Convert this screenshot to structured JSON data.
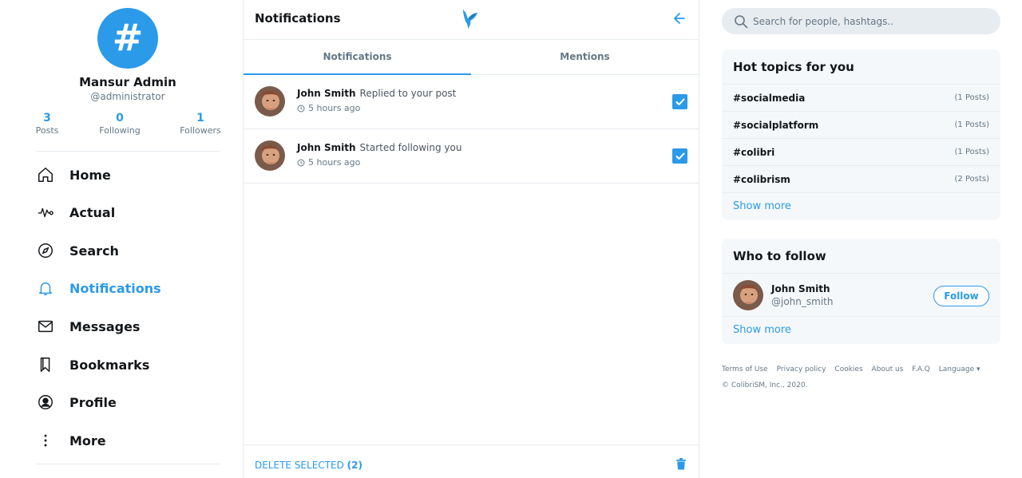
{
  "profile": {
    "avatar_symbol": "#",
    "name": "Mansur Admin",
    "handle": "@administrator",
    "stats": [
      {
        "value": "3",
        "label": "Posts"
      },
      {
        "value": "0",
        "label": "Following"
      },
      {
        "value": "1",
        "label": "Followers"
      }
    ]
  },
  "nav": {
    "items": [
      {
        "label": "Home",
        "icon": "home-icon"
      },
      {
        "label": "Actual",
        "icon": "activity-icon"
      },
      {
        "label": "Search",
        "icon": "compass-icon"
      },
      {
        "label": "Notifications",
        "icon": "bell-icon",
        "active": true
      },
      {
        "label": "Messages",
        "icon": "envelope-icon"
      },
      {
        "label": "Bookmarks",
        "icon": "bookmark-icon"
      },
      {
        "label": "Profile",
        "icon": "user-circle-icon"
      },
      {
        "label": "More",
        "icon": "more-vertical-icon"
      }
    ]
  },
  "main": {
    "title": "Notifications",
    "tabs": [
      {
        "label": "Notifications",
        "active": true
      },
      {
        "label": "Mentions",
        "active": false
      }
    ],
    "notifications": [
      {
        "name": "John Smith",
        "action": "Replied to your post",
        "time": "5 hours ago",
        "checked": true
      },
      {
        "name": "John Smith",
        "action": "Started following you",
        "time": "5 hours ago",
        "checked": true
      }
    ],
    "footer": {
      "delete_label": "DELETE SELECTED",
      "count": "(2)"
    }
  },
  "search": {
    "placeholder": "Search for people, hashtags.."
  },
  "hot_topics": {
    "title": "Hot topics for you",
    "items": [
      {
        "tag": "#socialmedia",
        "count": "(1 Posts)"
      },
      {
        "tag": "#socialplatform",
        "count": "(1 Posts)"
      },
      {
        "tag": "#colibri",
        "count": "(1 Posts)"
      },
      {
        "tag": "#colibrism",
        "count": "(2 Posts)"
      }
    ],
    "show_more": "Show more"
  },
  "who_to_follow": {
    "title": "Who to follow",
    "user": {
      "name": "John Smith",
      "handle": "@john_smith"
    },
    "follow_label": "Follow",
    "show_more": "Show more"
  },
  "footer": {
    "links": [
      "Terms of Use",
      "Privacy policy",
      "Cookies",
      "About us",
      "F.A.Q",
      "Language ▾"
    ],
    "copyright": "© ColibriSM, Inc., 2020."
  },
  "colors": {
    "accent": "#2b9ae9",
    "text": "#14171a",
    "muted": "#657786",
    "border": "#e6ecf0",
    "card": "#f5f8fa"
  }
}
